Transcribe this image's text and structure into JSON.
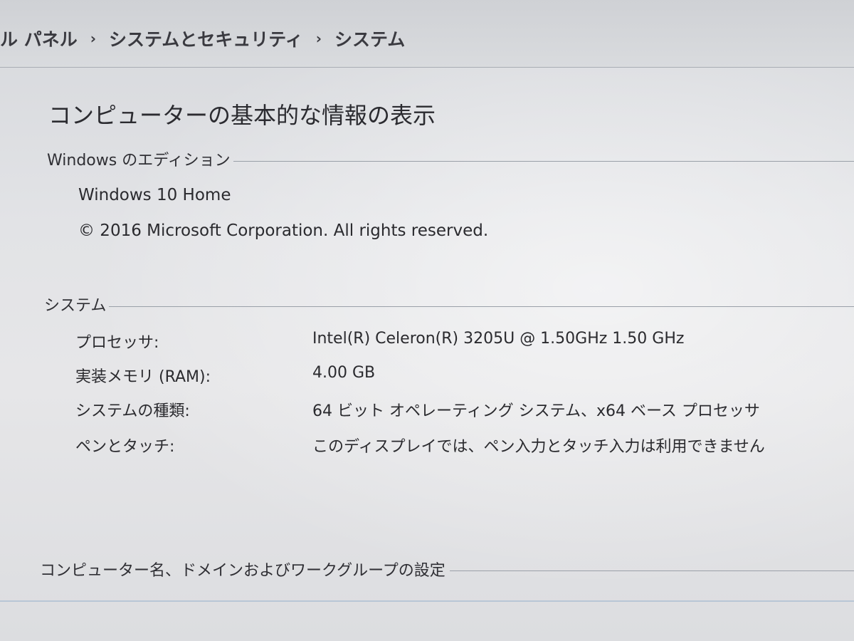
{
  "breadcrumb": {
    "items": [
      "ル パネル",
      "システムとセキュリティ",
      "システム"
    ],
    "separator": "›"
  },
  "page_title": "コンピューターの基本的な情報の表示",
  "edition": {
    "heading": "Windows のエディション",
    "name": "Windows 10 Home",
    "copyright": "© 2016 Microsoft Corporation. All rights reserved."
  },
  "system": {
    "heading": "システム",
    "rows": [
      {
        "label": "プロセッサ:",
        "value": "Intel(R) Celeron(R) 3205U @ 1.50GHz   1.50 GHz"
      },
      {
        "label": "実装メモリ (RAM):",
        "value": "4.00 GB"
      },
      {
        "label": "システムの種類:",
        "value": "64 ビット オペレーティング システム、x64 ベース プロセッサ"
      },
      {
        "label": "ペンとタッチ:",
        "value": "このディスプレイでは、ペン入力とタッチ入力は利用できません"
      }
    ]
  },
  "computer_name": {
    "heading": "コンピューター名、ドメインおよびワークグループの設定"
  }
}
